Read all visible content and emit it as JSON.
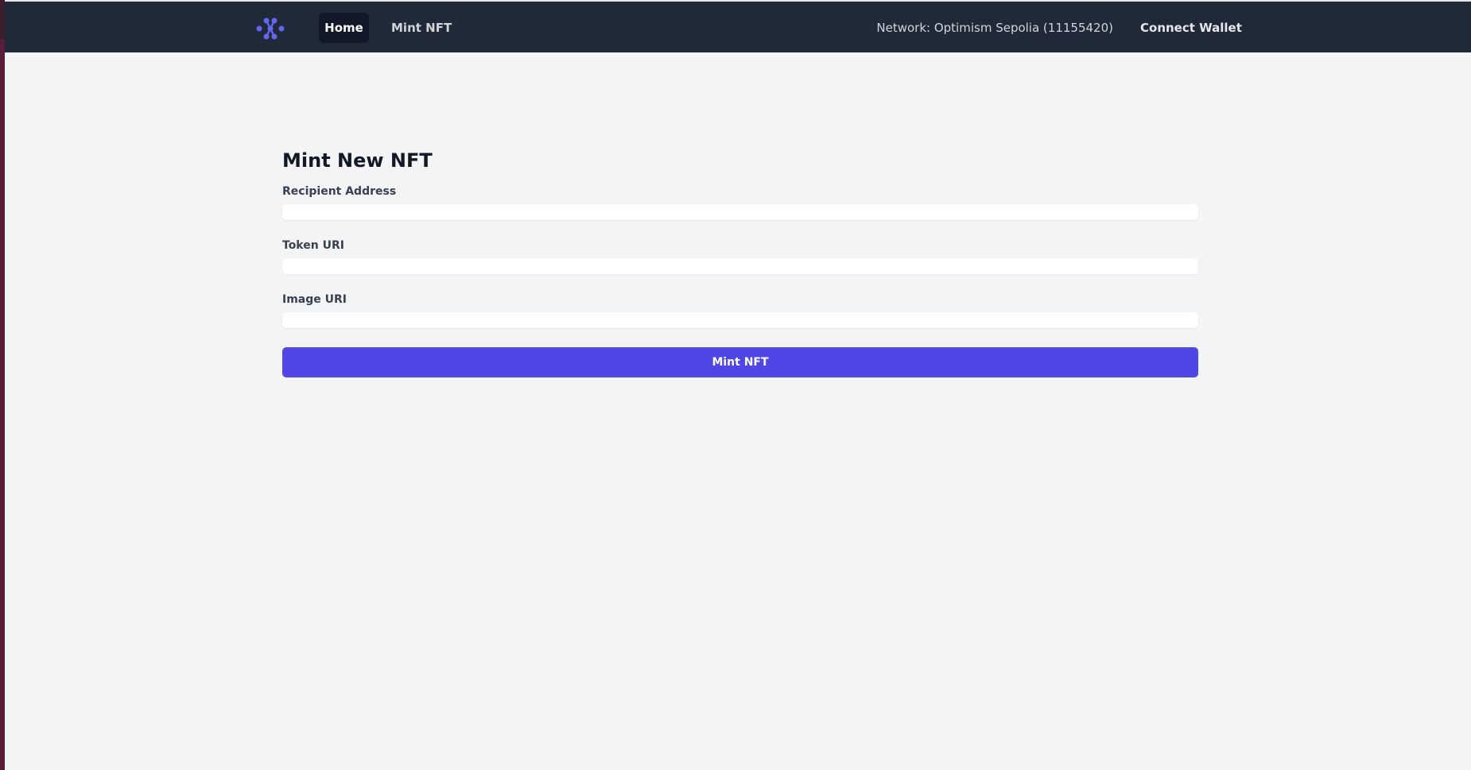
{
  "nav": {
    "logo_icon": "network-logo-icon",
    "accent_color": "#6366f1",
    "links": [
      {
        "label": "Home",
        "active": true
      },
      {
        "label": "Mint NFT",
        "active": false
      }
    ],
    "network_text": "Network: Optimism Sepolia (11155420)",
    "connect_label": "Connect Wallet"
  },
  "form": {
    "title": "Mint New NFT",
    "fields": [
      {
        "label": "Recipient Address",
        "value": "",
        "placeholder": ""
      },
      {
        "label": "Token URI",
        "value": "",
        "placeholder": ""
      },
      {
        "label": "Image URI",
        "value": "",
        "placeholder": ""
      }
    ],
    "submit_label": "Mint NFT",
    "button_color": "#4f46e5"
  }
}
